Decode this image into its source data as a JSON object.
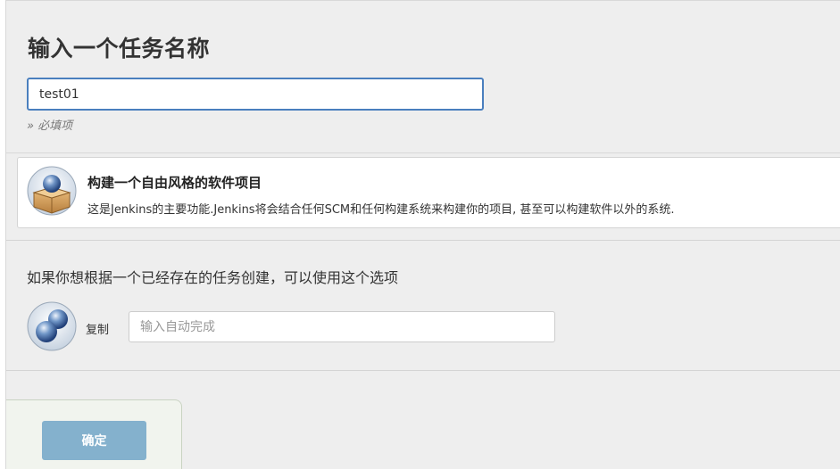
{
  "page_title": "输入一个任务名称",
  "item_name": {
    "value": "test01",
    "required_hint": "» 必填项"
  },
  "project_type": {
    "icon": "package-box-icon",
    "title": "构建一个自由风格的软件项目",
    "description": "这是Jenkins的主要功能.Jenkins将会结合任何SCM和任何构建系统来构建你的项目, 甚至可以构建软件以外的系统."
  },
  "copy_section": {
    "title": "如果你想根据一个已经存在的任务创建，可以使用这个选项",
    "icon": "copy-spheres-icon",
    "label": "复制",
    "placeholder": "输入自动完成"
  },
  "footer": {
    "ok_label": "确定"
  },
  "colors": {
    "focus_border": "#4a7fbe",
    "button_bg": "#84b1cd",
    "panel_bg": "#eeeeee"
  }
}
